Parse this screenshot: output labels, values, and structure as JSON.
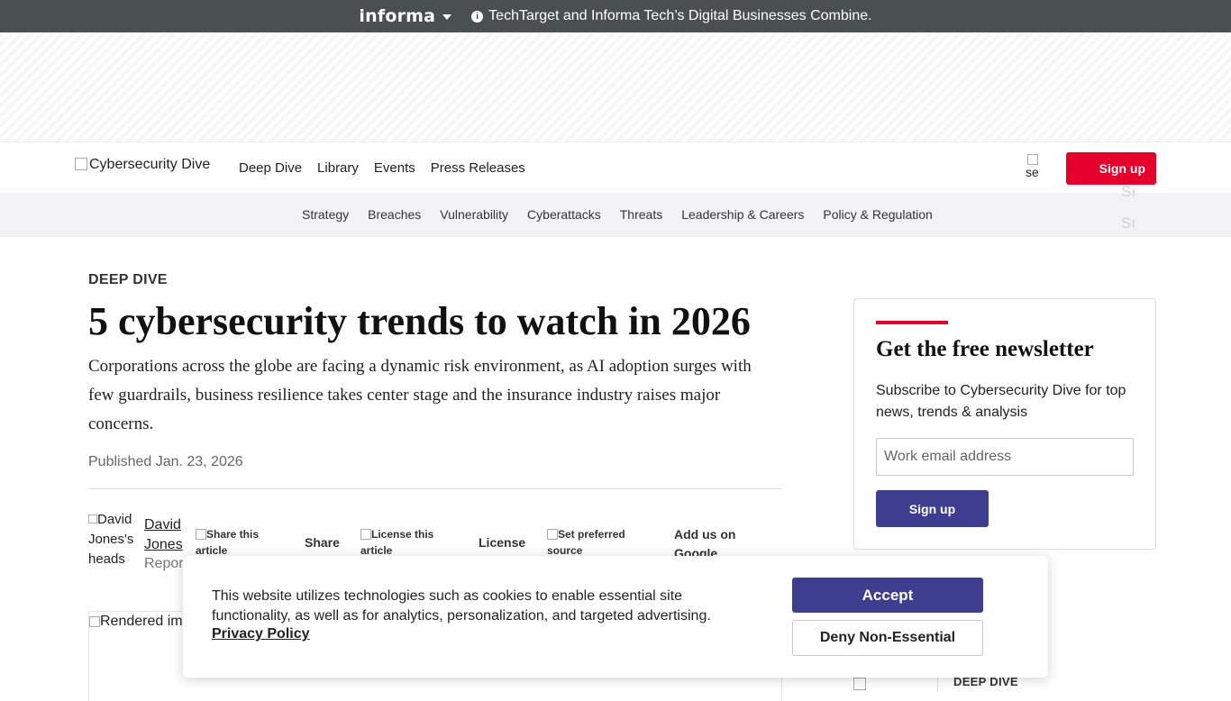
{
  "topbar": {
    "brand": "informa",
    "notice": "TechTarget and Informa Tech’s Digital Businesses Combine."
  },
  "header": {
    "logo_alt": "Cybersecurity Dive",
    "nav": [
      "Deep Dive",
      "Library",
      "Events",
      "Press Releases"
    ],
    "search_alt": "se",
    "signup_label": "Sign up"
  },
  "subnav": {
    "items": [
      "Strategy",
      "Breaches",
      "Vulnerability",
      "Cyberattacks",
      "Threats",
      "Leadership & Careers",
      "Policy & Regulation"
    ],
    "ghost_1": "Sı",
    "ghost_2": "Sı"
  },
  "article": {
    "kicker": "DEEP DIVE",
    "title": "5 cybersecurity trends to watch in 2026",
    "dek": "Corporations across the globe are facing a dynamic risk environment, as AI adoption surges with few guardrails, business resilience takes center stage and the insurance industry raises major concerns.",
    "published": "Published Jan. 23, 2026",
    "byline": {
      "avatar_alt": "David Jones's heads",
      "author": "David Jones",
      "role": "Repor",
      "share_img_alt": "Share this article",
      "share_label": "Share",
      "license_img_alt": "License this article",
      "license_label": "License",
      "source_img_alt": "Set preferred source",
      "google_label": "Add us on Google"
    },
    "hero_alt": "Rendered im"
  },
  "newsletter": {
    "title": "Get the free newsletter",
    "description": "Subscribe to Cybersecurity Dive for top news, trends & analysis",
    "email_placeholder": "Work email address",
    "button_label": "Sign up"
  },
  "sidebar": {
    "kicker": "DEEP DIVE"
  },
  "cookie": {
    "message": "This website utilizes technologies such as cookies to enable essential site functionality, as well as for analytics, personalization, and targeted advertising.",
    "policy_link": "Privacy Policy",
    "accept_label": "Accept",
    "deny_label": "Deny Non-Essential"
  },
  "colors": {
    "topbar_bg": "#4a4f4f",
    "accent_red": "#e4002b",
    "button_purple": "#3f3d8f",
    "subnav_bg": "#f2f2f7"
  }
}
